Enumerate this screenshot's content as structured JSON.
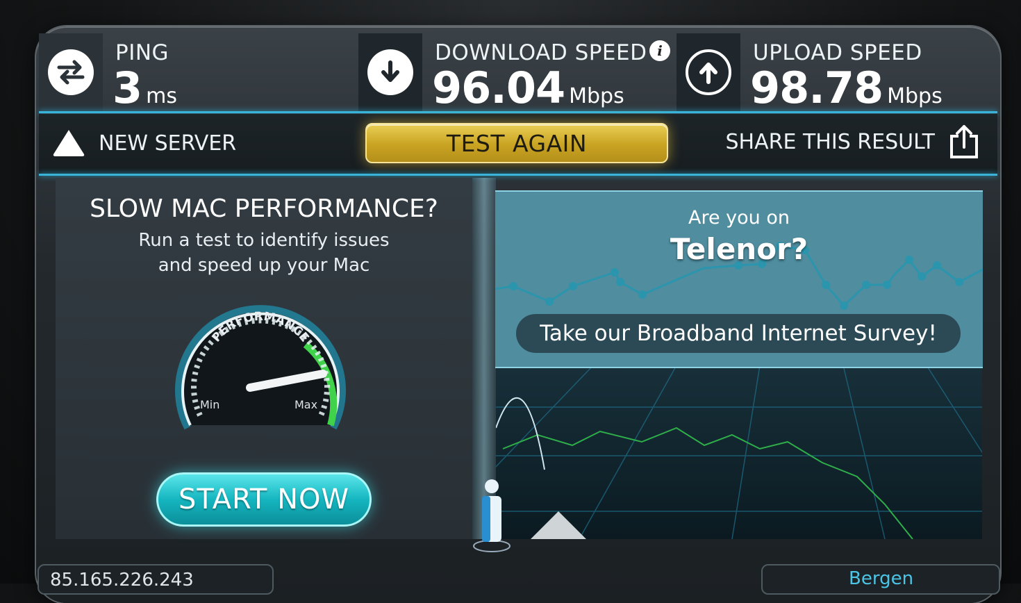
{
  "ping": {
    "label": "PING",
    "value": "3",
    "unit": "ms"
  },
  "download": {
    "label": "DOWNLOAD SPEED",
    "value": "96.04",
    "unit": "Mbps",
    "info_glyph": "i"
  },
  "upload": {
    "label": "UPLOAD SPEED",
    "value": "98.78",
    "unit": "Mbps"
  },
  "actions": {
    "new_server": "NEW SERVER",
    "test_again": "TEST AGAIN",
    "share": "SHARE THIS RESULT"
  },
  "ad": {
    "title": "SLOW MAC PERFORMANCE?",
    "subtitle_line1": "Run a test to identify issues",
    "subtitle_line2": "and speed up your Mac",
    "gauge_label": "PERFORMANCE",
    "gauge_min": "Min",
    "gauge_max": "Max",
    "cta": "START NOW"
  },
  "survey": {
    "question": "Are you on",
    "isp": "Telenor?",
    "cta": "Take our Broadband Internet Survey!"
  },
  "footer": {
    "ip": "85.165.226.243",
    "server": "Bergen"
  },
  "colors": {
    "accent_cyan": "#39b4d8",
    "test_again_gold": "#d4b030",
    "start_now_teal": "#15b6c0",
    "gauge_green": "#3fd24a",
    "survey_bg": "#4f8d9f"
  },
  "icons": {
    "ping": "two-way-arrows-icon",
    "download": "down-arrow-circle-icon",
    "upload": "up-arrow-circle-icon",
    "new_server": "triangle-icon",
    "share": "share-icon",
    "info": "info-icon"
  }
}
